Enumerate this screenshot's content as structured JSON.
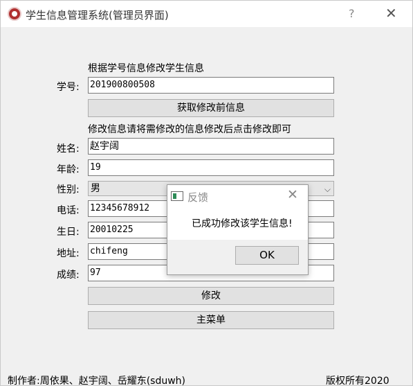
{
  "window": {
    "title": "学生信息管理系统(管理员界面)",
    "help": "?",
    "close": "✕"
  },
  "form": {
    "lookup_hint": "根据学号信息修改学生信息",
    "student_id_label": "学号:",
    "student_id_value": "201900800508",
    "fetch_button": "获取修改前信息",
    "edit_hint": "修改信息请将需修改的信息修改后点击修改即可",
    "name_label": "姓名:",
    "name_value": "赵宇阔",
    "age_label": "年龄:",
    "age_value": "19",
    "gender_label": "性别:",
    "gender_value": "男",
    "phone_label": "电话:",
    "phone_value": "12345678912",
    "birthday_label": "生日:",
    "birthday_value": "20010225",
    "address_label": "地址:",
    "address_value": "chifeng",
    "score_label": "成绩:",
    "score_value": "97",
    "modify_button": "修改",
    "main_menu_button": "主菜单"
  },
  "footer": {
    "authors": "制作者:周依果、赵宇阔、岳耀东(sduwh)",
    "copyright": "版权所有2020"
  },
  "dialog": {
    "title": "反馈",
    "close": "✕",
    "message": "已成功修改该学生信息!",
    "ok_button": "OK"
  },
  "colors": {
    "window_bg": "#f0f0f0",
    "titlebar_bg": "#ffffff",
    "button_bg": "#e1e1e1",
    "border": "#adadad"
  }
}
